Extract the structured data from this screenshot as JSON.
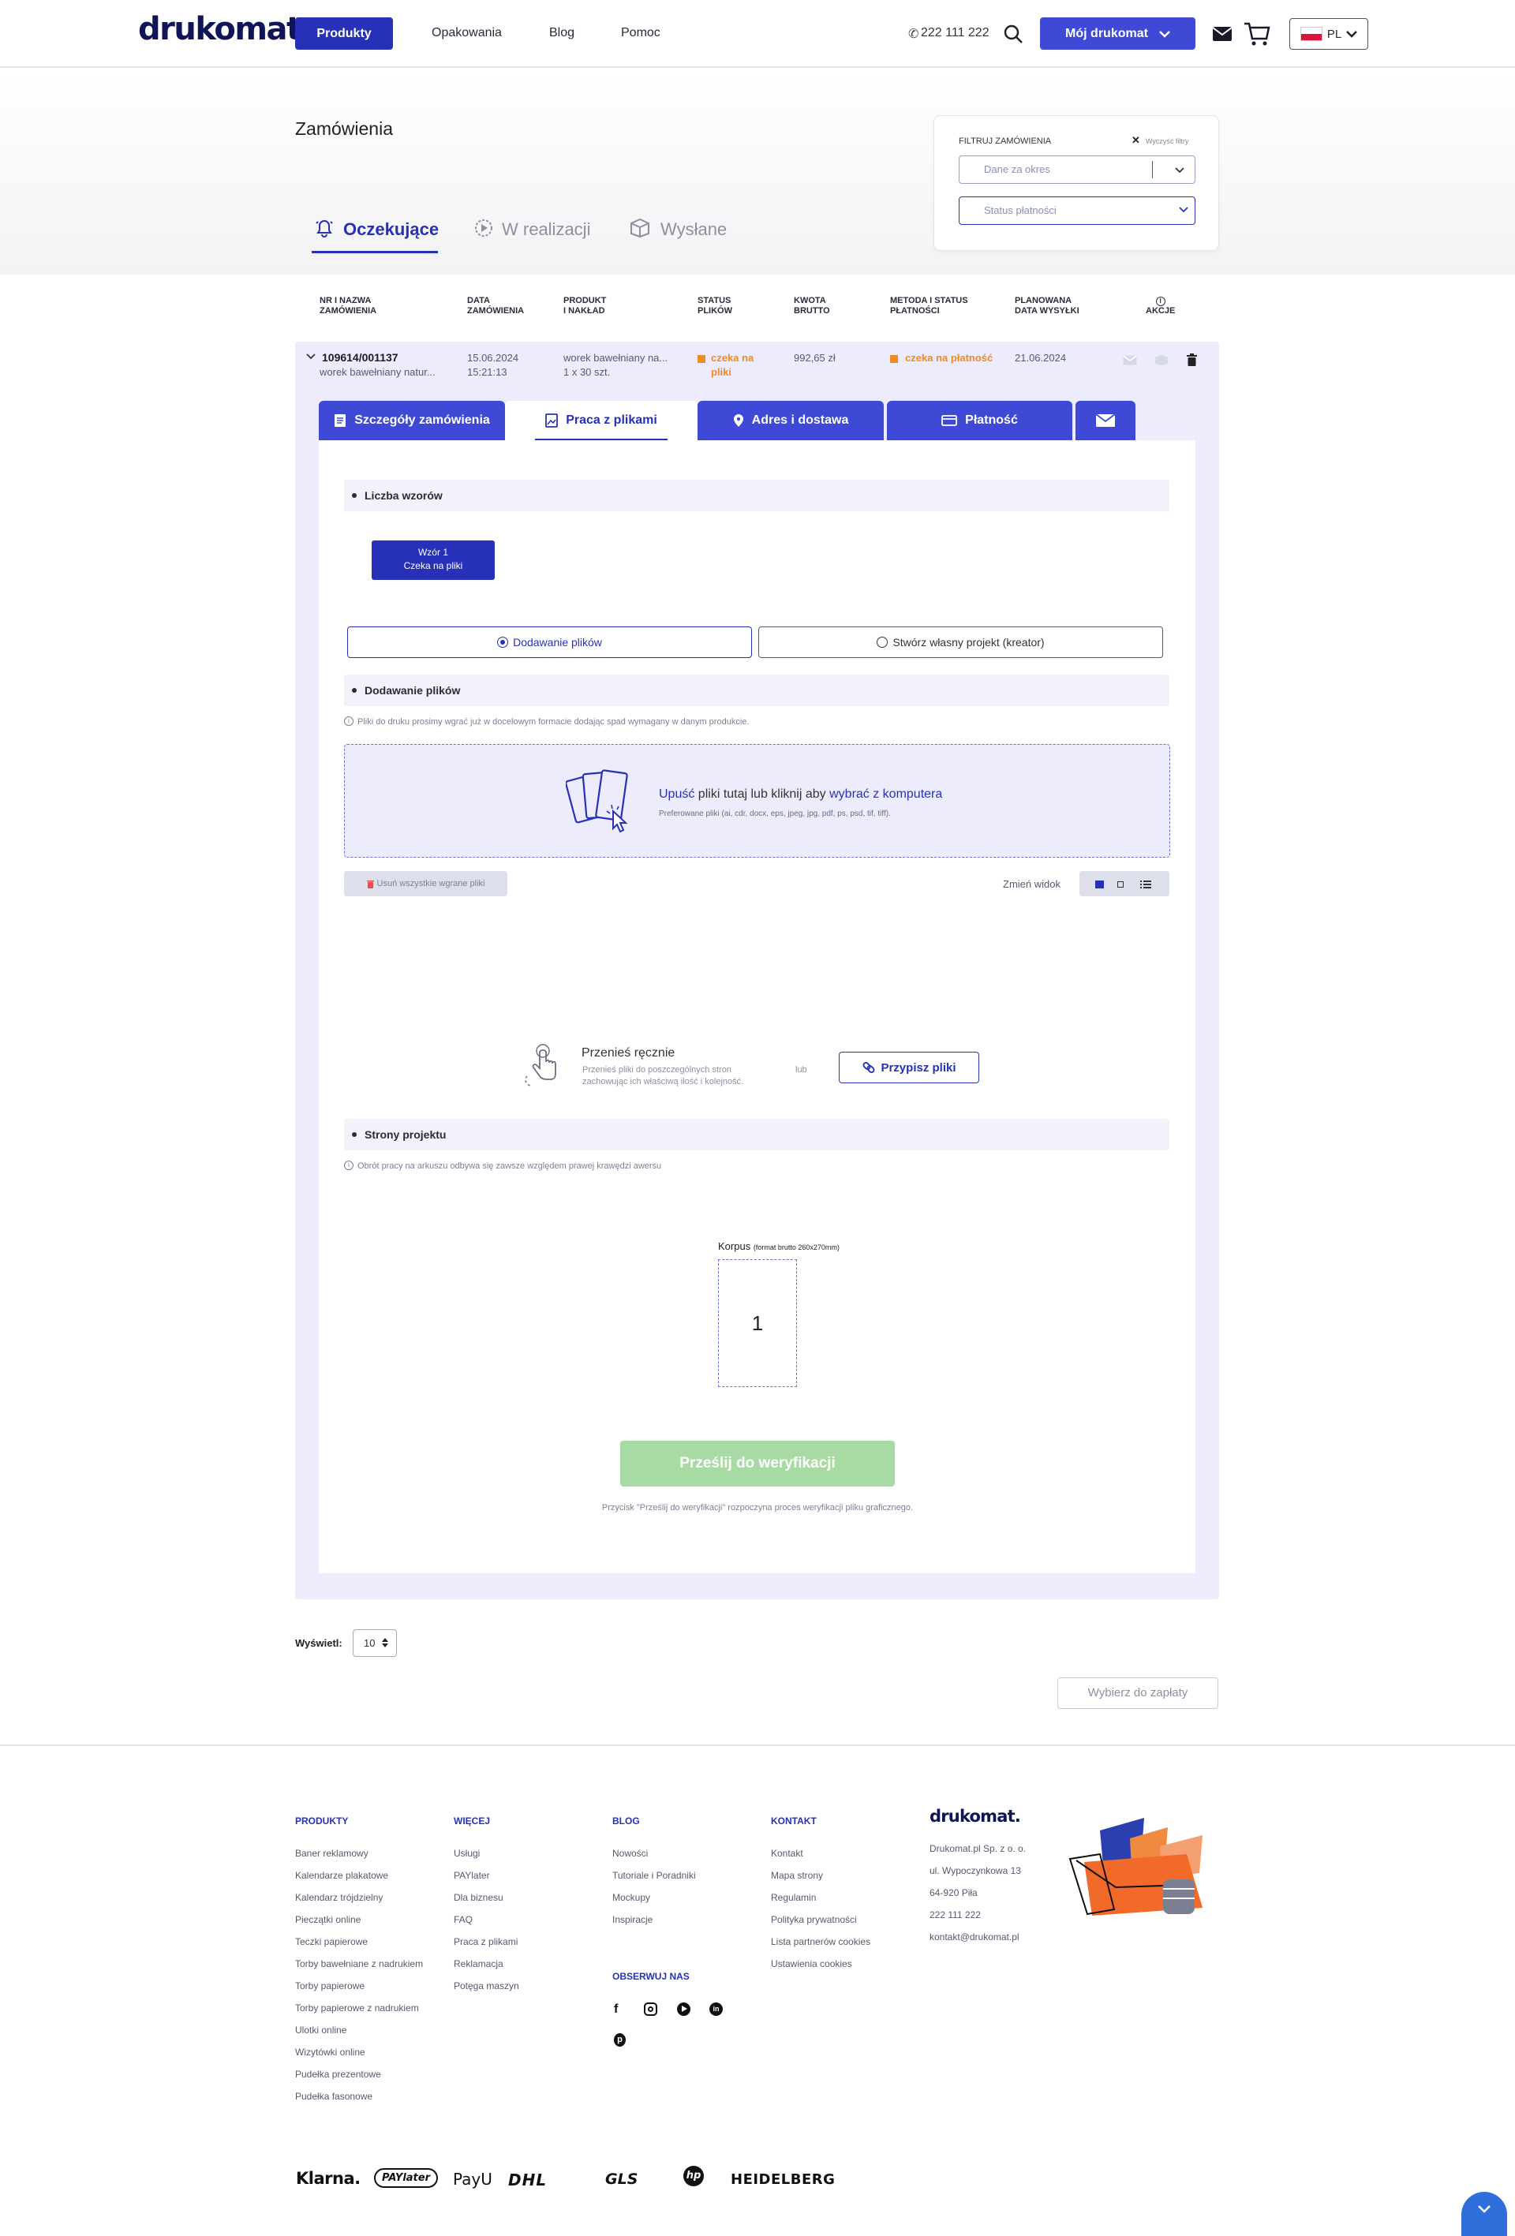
{
  "header": {
    "logo": "drukomat.",
    "nav": [
      "Produkty",
      "Opakowania",
      "Blog",
      "Pomoc"
    ],
    "phone": "222 111 222",
    "account_button": "Mój drukomat",
    "language": "PL"
  },
  "page": {
    "title": "Zamówienia",
    "tabs": [
      "Oczekujące",
      "W realizacji",
      "Wysłane"
    ]
  },
  "filters": {
    "title": "FILTRUJ ZAMÓWIENIA",
    "clear": "Wyczyść filtry",
    "period_placeholder": "Dane za okres",
    "payment_placeholder": "Status płatności"
  },
  "table": {
    "headers": [
      [
        "NR I NAZWA",
        "ZAMÓWIENIA"
      ],
      [
        "DATA",
        "ZAMÓWIENIA"
      ],
      [
        "PRODUKT",
        "I NAKŁAD"
      ],
      [
        "STATUS",
        "PLIKÓW"
      ],
      [
        "KWOTA",
        "BRUTTO"
      ],
      [
        "METODA I STATUS",
        "PŁATNOŚCI"
      ],
      [
        "PLANOWANA",
        "DATA WYSYŁKI"
      ],
      [
        "",
        "AKCJE"
      ]
    ]
  },
  "order": {
    "number": "109614/001137",
    "name": "worek bawełniany natur...",
    "date": "15.06.2024",
    "time": "15:21:13",
    "product": "worek bawełniany na...",
    "quantity": "1 x 30 szt.",
    "file_status": [
      "czeka na",
      "pliki"
    ],
    "amount": "992,65 zł",
    "payment_status": "czeka na płatność",
    "ship_date": "21.06.2024"
  },
  "detail_tabs": [
    "Szczegóły zamówienia",
    "Praca z plikami",
    "Adres i dostawa",
    "Płatność"
  ],
  "files_panel": {
    "designs_section": "Liczba wzorów",
    "design_button": [
      "Wzór 1",
      "Czeka na pliki"
    ],
    "option_upload": "Dodawanie plików",
    "option_creator": "Stwórz własny projekt (kreator)",
    "upload_section": "Dodawanie plików",
    "upload_hint": "Pliki do druku prosimy wgrać już w docelowym formacie dodając spad wymagany w danym produkcie.",
    "drop_word": "Upuść",
    "drop_middle": " pliki tutaj lub kliknij aby ",
    "drop_link": "wybrać z komputera",
    "drop_formats": "Preferowane pliki (ai, cdr, docx, eps, jpeg, jpg, pdf, ps, psd, tif, tiff).",
    "remove_all": "Usuń wszystkie wgrane pliki",
    "change_view": "Zmień widok",
    "move_title": "Przenieś ręcznie",
    "move_desc_1": "Przenieś pliki do poszczególnych stron",
    "move_desc_2": "zachowując ich właściwą ilość i kolejność.",
    "or": "lub",
    "assign_button": "Przypisz pliki",
    "pages_section": "Strony projektu",
    "pages_hint": "Obrót pracy na arkuszu odbywa się zawsze względem prawej krawędzi awersu",
    "page_label": "Korpus",
    "page_format": "(format brutto 260x270mm)",
    "page_number": "1",
    "submit": "Prześlij do weryfikacji",
    "submit_hint": "Przycisk \"Prześlij do weryfikacji\" rozpoczyna proces weryfikacji pliku graficznego."
  },
  "pagination": {
    "label": "Wyświetl:",
    "value": "10",
    "pay_button": "Wybierz do zapłaty"
  },
  "footer": {
    "columns": [
      {
        "title": "PRODUKTY",
        "links": [
          "Baner reklamowy",
          "Kalendarze plakatowe",
          "Kalendarz trójdzielny",
          "Pieczątki online",
          "Teczki papierowe",
          "Torby bawełniane z nadrukiem",
          "Torby papierowe",
          "Torby papierowe z nadrukiem",
          "Ulotki online",
          "Wizytówki online",
          "Pudełka prezentowe",
          "Pudełka fasonowe"
        ]
      },
      {
        "title": "WIĘCEJ",
        "links": [
          "Usługi",
          "PAYlater",
          "Dla biznesu",
          "FAQ",
          "Praca z plikami",
          "Reklamacja",
          "Potęga maszyn"
        ]
      },
      {
        "title": "BLOG",
        "links": [
          "Nowości",
          "Tutoriale i Poradniki",
          "Mockupy",
          "Inspiracje"
        ]
      },
      {
        "title": "KONTAKT",
        "links": [
          "Kontakt",
          "Mapa strony",
          "Regulamin",
          "Polityka prywatności",
          "Lista partnerów cookies",
          "Ustawienia cookies"
        ]
      }
    ],
    "follow_title": "OBSERWUJ NAS",
    "logo": "drukomat.",
    "company": [
      "Drukomat.pl Sp. z o. o.",
      "ul. Wypoczynkowa 13",
      "64-920 Piła",
      "222 111 222",
      "kontakt@drukomat.pl"
    ],
    "brands": [
      "Klarna.",
      "PAYlater",
      "PayU",
      "DHL",
      "GLS",
      "hp",
      "HEIDELBERG"
    ]
  },
  "colors": {
    "primary": "#2731b8",
    "accent_orange": "#f08a24",
    "submit_green": "#a8dba4",
    "panel_bg": "#ececfc"
  }
}
